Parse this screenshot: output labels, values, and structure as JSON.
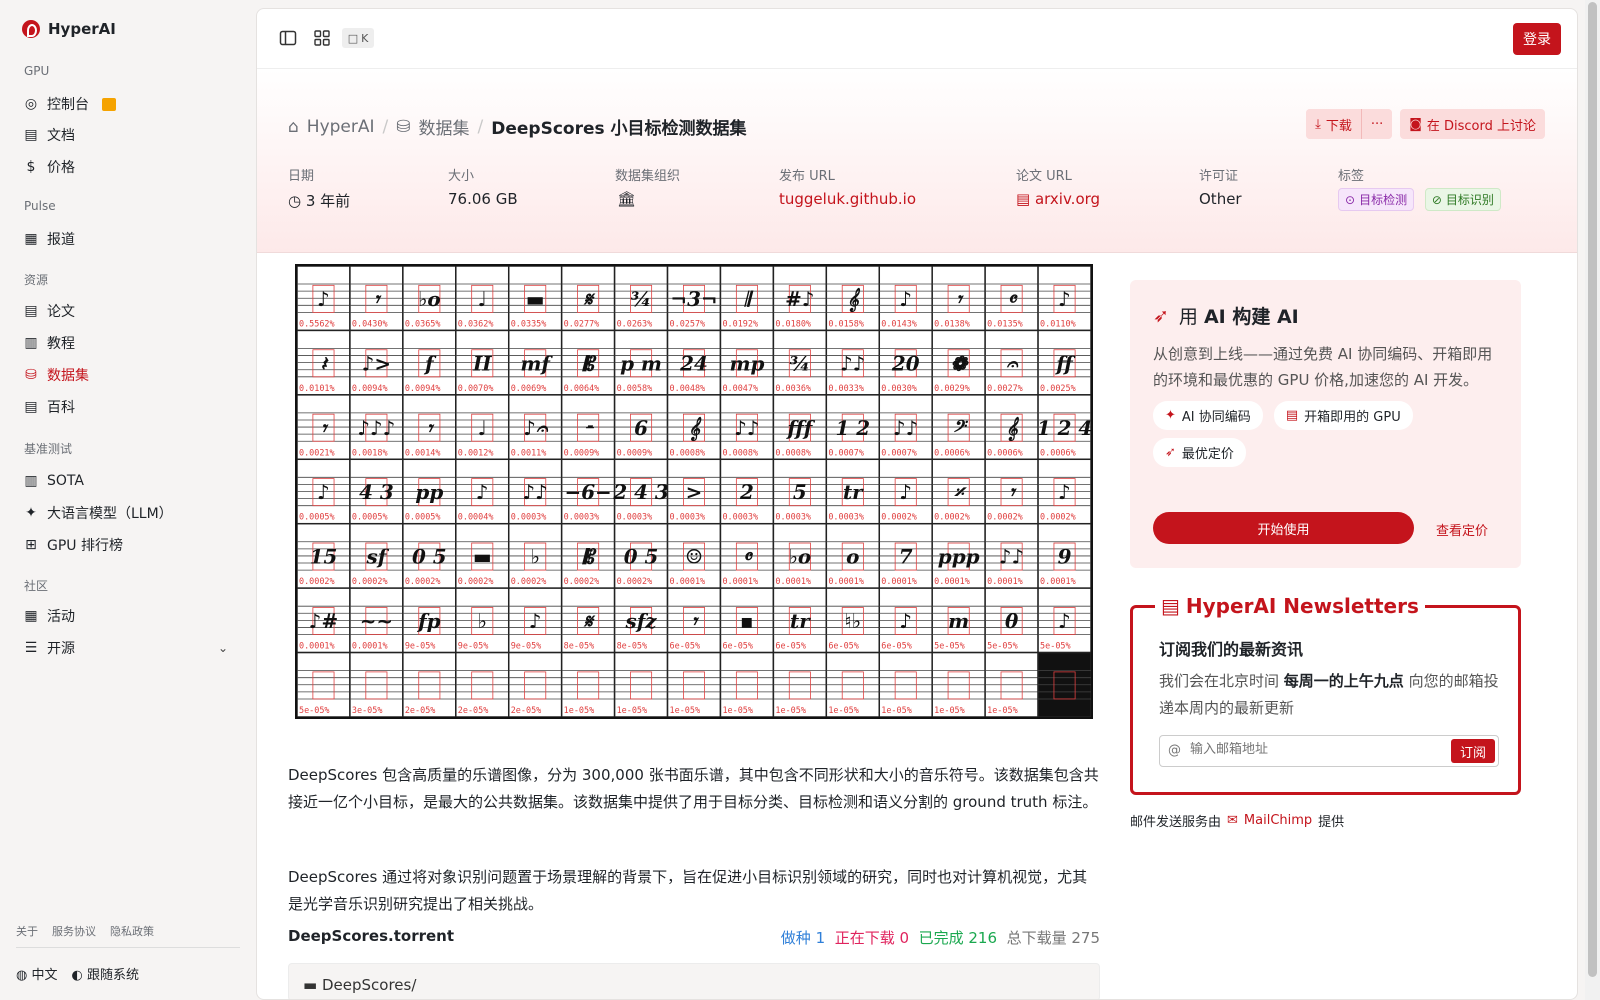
{
  "app": {
    "name": "HyperAI",
    "login": "登录",
    "kbd": "K"
  },
  "sidebar": {
    "sections": [
      "GPU",
      "Pulse",
      "资源",
      "基准测试",
      "社区"
    ],
    "items": [
      "控制台",
      "文档",
      "价格",
      "报道",
      "论文",
      "教程",
      "数据集",
      "百科",
      "SOTA",
      "大语言模型（LLM）",
      "GPU 排行榜",
      "活动",
      "开源"
    ],
    "footer": [
      "关于",
      "服务协议",
      "隐私政策"
    ],
    "lang": "中文",
    "follow": "跟随系统"
  },
  "breadcrumb": {
    "home": "HyperAI",
    "datasets": "数据集",
    "current": "DeepScores 小目标检测数据集"
  },
  "actions": {
    "download": "下载",
    "more": "···",
    "discord": "在 Discord 上讨论"
  },
  "meta": {
    "labels": [
      "日期",
      "大小",
      "数据集组织",
      "发布 URL",
      "论文 URL",
      "许可证",
      "标签"
    ],
    "date": "3 年前",
    "size": "76.06 GB",
    "release_url": "tuggeluk.github.io",
    "paper_url": "arxiv.org",
    "license": "Other",
    "tags": [
      "目标检测",
      "目标识别"
    ]
  },
  "description": [
    "DeepScores 包含高质量的乐谱图像，分为 300,000 张书面乐谱，其中包含不同形状和大小的音乐符号。该数据集包含共接近一亿个小目标，是最大的公共数据集。该数据集中提供了用于目标分类、目标检测和语义分割的 ground truth 标注。",
    "DeepScores 通过将对象识别问题置于场景理解的背景下，旨在促进小目标识别领域的研究，同时也对计算机视觉，尤其是光学音乐识别研究提出了相关挑战。"
  ],
  "torrent": {
    "name": "DeepScores.torrent",
    "seed_label": "做种",
    "seed": "1",
    "downloading_label": "正在下载",
    "downloading": "0",
    "done_label": "已完成",
    "done": "216",
    "total_label": "总下载量",
    "total": "275",
    "folder": "DeepScores/"
  },
  "ai_card": {
    "title_prefix": "用 ",
    "title_bold": "AI 构建 AI",
    "desc": "从创意到上线——通过免费 AI 协同编码、开箱即用的环境和最优惠的 GPU 价格,加速您的 AI 开发。",
    "chips": [
      "AI 协同编码",
      "开箱即用的 GPU",
      "最优定价"
    ],
    "start": "开始使用",
    "pricing": "查看定价"
  },
  "newsletter": {
    "title": "HyperAI Newsletters",
    "subtitle": "订阅我们的最新资讯",
    "desc_pre": "我们会在北京时间 ",
    "desc_bold": "每周一的上午九点",
    "desc_post": " 向您的邮箱投递本周内的最新更新",
    "placeholder": "输入邮箱地址",
    "subscribe": "订阅",
    "provider_pre": "邮件发送服务由",
    "provider": "MailChimp",
    "provider_post": "提供"
  },
  "scores_grid": {
    "rows": 7,
    "cols": 15,
    "labels": [
      "0.5562%",
      "0.0430%",
      "0.0365%",
      "0.0362%",
      "0.0335%",
      "0.0277%",
      "0.0263%",
      "0.0257%",
      "0.0192%",
      "0.0180%",
      "0.0158%",
      "0.0143%",
      "0.0138%",
      "0.0135%",
      "0.0110%",
      "0.0101%",
      "0.0094%",
      "0.0094%",
      "0.0070%",
      "0.0069%",
      "0.0064%",
      "0.0058%",
      "0.0048%",
      "0.0047%",
      "0.0036%",
      "0.0033%",
      "0.0030%",
      "0.0029%",
      "0.0027%",
      "0.0025%",
      "0.0021%",
      "0.0018%",
      "0.0014%",
      "0.0012%",
      "0.0011%",
      "0.0009%",
      "0.0009%",
      "0.0008%",
      "0.0008%",
      "0.0008%",
      "0.0007%",
      "0.0007%",
      "0.0006%",
      "0.0006%",
      "0.0006%",
      "0.0005%",
      "0.0005%",
      "0.0005%",
      "0.0004%",
      "0.0003%",
      "0.0003%",
      "0.0003%",
      "0.0003%",
      "0.0003%",
      "0.0003%",
      "0.0003%",
      "0.0002%",
      "0.0002%",
      "0.0002%",
      "0.0002%",
      "0.0002%",
      "0.0002%",
      "0.0002%",
      "0.0002%",
      "0.0002%",
      "0.0002%",
      "0.0002%",
      "0.0001%",
      "0.0001%",
      "0.0001%",
      "0.0001%",
      "0.0001%",
      "0.0001%",
      "0.0001%",
      "0.0001%",
      "0.0001%",
      "0.0001%",
      "9e-05%",
      "9e-05%",
      "9e-05%",
      "8e-05%",
      "8e-05%",
      "6e-05%",
      "6e-05%",
      "6e-05%",
      "6e-05%",
      "6e-05%",
      "5e-05%",
      "5e-05%",
      "5e-05%",
      "5e-05%",
      "3e-05%",
      "2e-05%",
      "2e-05%",
      "2e-05%",
      "1e-05%",
      "1e-05%",
      "1e-05%",
      "1e-05%",
      "1e-05%",
      "1e-05%",
      "1e-05%",
      "1e-05%",
      "1e-05%",
      ""
    ],
    "glyphs": [
      "♪",
      "𝄾",
      "♭o",
      "♩",
      "▬",
      "𝄋",
      "¾",
      "¬3¬",
      "𝄂",
      "#♪",
      "𝄞",
      "♪",
      "𝄾",
      "𝄴",
      "♪",
      "𝄽",
      "♪>",
      "f",
      "II",
      "mf",
      "𝄡",
      "p m",
      "24",
      "mp",
      "¾",
      "♪♪",
      "20",
      "❁",
      "𝄐",
      "ff",
      "𝄾",
      "♪♪♪",
      "𝄾",
      "♩",
      "♪𝄐",
      "𝄼",
      "6",
      "𝄞",
      "♪♪",
      "fff",
      "1 2",
      "♪♪",
      "𝄢",
      "𝄞",
      "1 2 4",
      "♪",
      "4 3",
      "pp",
      "♪",
      "♪♪",
      "−6−",
      "2 4 3",
      ">",
      "2",
      "5",
      "tr",
      "♪",
      "𝄎",
      "𝄾",
      "♪",
      "15",
      "sf",
      "0 5",
      "▬",
      "♭",
      "𝄡",
      "0 5",
      "☺",
      "𝄴",
      "♭o",
      "o",
      "7",
      "ppp",
      "♪♪",
      "9",
      "♪#",
      "~~",
      "fp",
      "♭",
      "♪",
      "𝄋",
      "sfz",
      "𝄾",
      "▪",
      "tr",
      "♮♭",
      "♪",
      "m",
      "θ",
      "♪"
    ]
  }
}
